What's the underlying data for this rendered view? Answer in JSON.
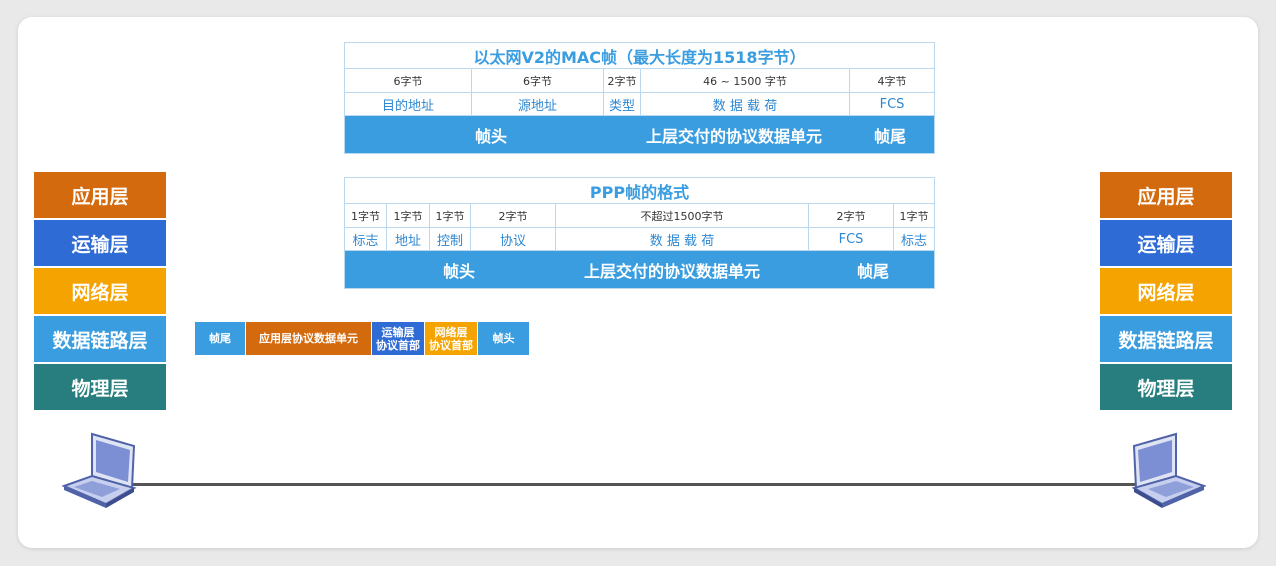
{
  "mac_frame": {
    "title": "以太网V2的MAC帧（最大长度为1518字节）",
    "sizes": [
      "6字节",
      "6字节",
      "2字节",
      "46 ~ 1500 字节",
      "4字节"
    ],
    "fields": [
      "目的地址",
      "源地址",
      "类型",
      "数 据 载 荷",
      "FCS"
    ],
    "bar": {
      "header": "帧头",
      "payload": "上层交付的协议数据单元",
      "trailer": "帧尾"
    }
  },
  "ppp_frame": {
    "title": "PPP帧的格式",
    "sizes": [
      "1字节",
      "1字节",
      "1字节",
      "2字节",
      "不超过1500字节",
      "2字节",
      "1字节"
    ],
    "fields": [
      "标志",
      "地址",
      "控制",
      "协议",
      "数 据 载 荷",
      "FCS",
      "标志"
    ],
    "bar": {
      "header": "帧头",
      "payload": "上层交付的协议数据单元",
      "trailer": "帧尾"
    }
  },
  "encapsulation": {
    "segments": [
      {
        "label": "帧尾",
        "color": "#3a9de0"
      },
      {
        "label": "应用层协议数据单元",
        "color": "#d46a0e"
      },
      {
        "label": "运输层\n协议首部",
        "color": "#2f6bd4"
      },
      {
        "label": "网络层\n协议首部",
        "color": "#f5a300"
      },
      {
        "label": "帧头",
        "color": "#3a9de0"
      }
    ]
  },
  "left_stack": {
    "layers": [
      "应用层",
      "运输层",
      "网络层",
      "数据链路层",
      "物理层"
    ]
  },
  "right_stack": {
    "layers": [
      "应用层",
      "运输层",
      "网络层",
      "数据链路层",
      "物理层"
    ]
  },
  "colors": {
    "application": "#d46a0e",
    "transport": "#2f6bd4",
    "network": "#f5a300",
    "datalink": "#3a9de0",
    "physical": "#287e7e"
  }
}
